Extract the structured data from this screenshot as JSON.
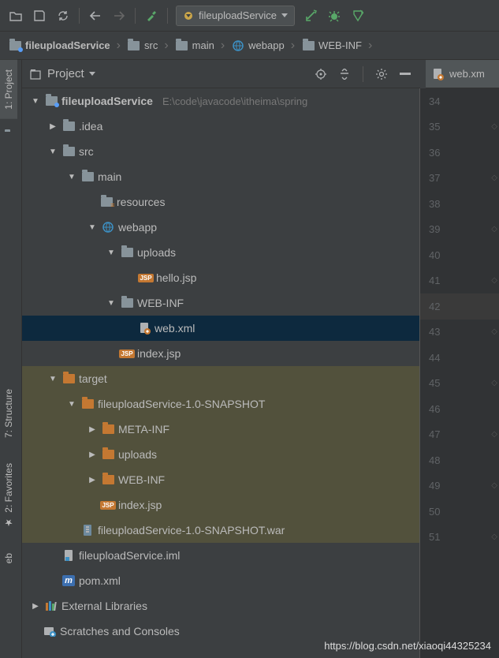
{
  "toolbar": {
    "run_config_label": "fileuploadService"
  },
  "breadcrumb": [
    {
      "label": "fileuploadService",
      "icon": "module"
    },
    {
      "label": "src",
      "icon": "folder"
    },
    {
      "label": "main",
      "icon": "folder"
    },
    {
      "label": "webapp",
      "icon": "web"
    },
    {
      "label": "WEB-INF",
      "icon": "folder"
    }
  ],
  "panel": {
    "title": "Project"
  },
  "stripe": {
    "project": "1: Project",
    "structure": "7: Structure",
    "favorites": "2: Favorites",
    "eb": "eb"
  },
  "editor_tab": {
    "label": "web.xm"
  },
  "gutter_lines": [
    "34",
    "35",
    "36",
    "37",
    "38",
    "39",
    "40",
    "41",
    "42",
    "43",
    "44",
    "45",
    "46",
    "47",
    "48",
    "49",
    "50",
    "51"
  ],
  "gutter_highlight_index": 8,
  "tree": {
    "root": {
      "name": "fileuploadService",
      "path": "E:\\code\\javacode\\itheima\\spring"
    },
    "idea": ".idea",
    "src": "src",
    "main": "main",
    "resources": "resources",
    "webapp": "webapp",
    "uploads": "uploads",
    "hello_jsp": "hello.jsp",
    "webinf": "WEB-INF",
    "web_xml": "web.xml",
    "index_jsp": "index.jsp",
    "target": "target",
    "snapshot": "fileuploadService-1.0-SNAPSHOT",
    "metainf": "META-INF",
    "uploads2": "uploads",
    "webinf2": "WEB-INF",
    "index_jsp2": "index.jsp",
    "war": "fileuploadService-1.0-SNAPSHOT.war",
    "iml": "fileuploadService.iml",
    "pom": "pom.xml",
    "ext_libs": "External Libraries",
    "scratches": "Scratches and Consoles"
  },
  "watermark": "https://blog.csdn.net/xiaoqi44325234"
}
